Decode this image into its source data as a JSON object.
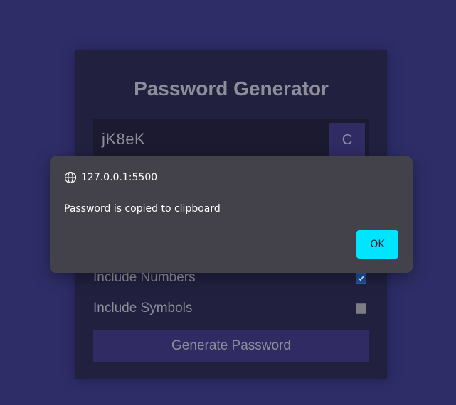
{
  "app": {
    "title": "Password Generator"
  },
  "result": {
    "password": "jK8eK",
    "copy_label": "C"
  },
  "settings": [
    {
      "label": "Include Numbers",
      "checked": true
    },
    {
      "label": "Include Symbols",
      "checked": false
    }
  ],
  "generate_label": "Generate Password",
  "dialog": {
    "origin": "127.0.0.1:5500",
    "message": "Password is copied to clipboard",
    "ok_label": "OK",
    "globe_icon": "globe-icon"
  },
  "colors": {
    "background": "#2e2d67",
    "card": "#21203f",
    "button": "#302b63",
    "dialog": "#434149",
    "ok_button": "#00e5ff",
    "checkbox_checked": "#1d4f9e"
  }
}
